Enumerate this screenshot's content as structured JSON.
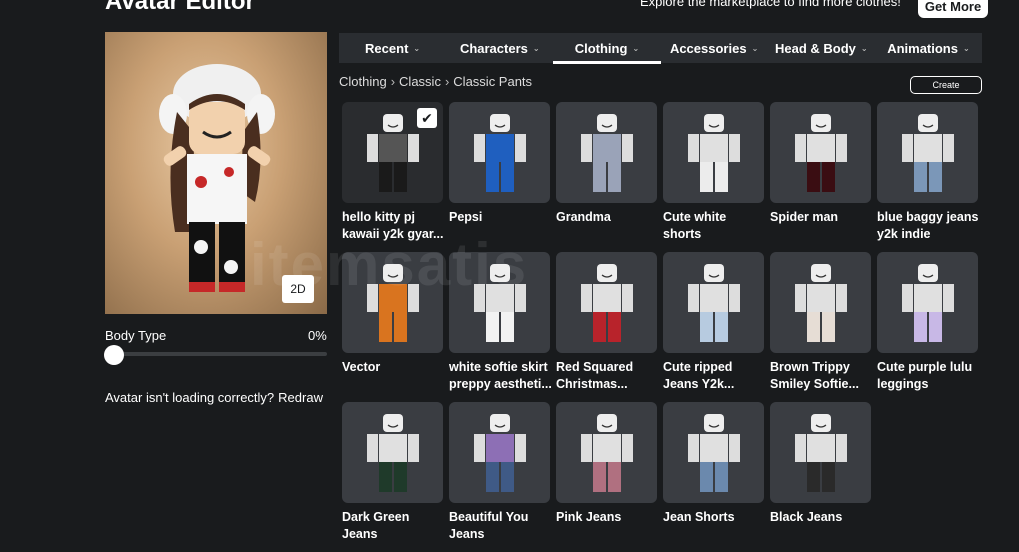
{
  "header": {
    "title": "Avatar Editor",
    "promo_text": "Explore the marketplace to find more clothes!",
    "get_more_label": "Get More"
  },
  "avatar": {
    "view_toggle_label": "2D",
    "body_type_label": "Body Type",
    "body_type_value": "0%",
    "body_type_level": 0,
    "loading_note": "Avatar isn't loading correctly?",
    "redraw_label": "Redraw"
  },
  "tabs": [
    {
      "label": "Recent",
      "active": false
    },
    {
      "label": "Characters",
      "active": false
    },
    {
      "label": "Clothing",
      "active": true
    },
    {
      "label": "Accessories",
      "active": false
    },
    {
      "label": "Head & Body",
      "active": false
    },
    {
      "label": "Animations",
      "active": false
    }
  ],
  "breadcrumb": [
    "Clothing",
    "Classic",
    "Classic Pants"
  ],
  "create_label": "Create",
  "items": [
    {
      "name": "hello kitty pj kawaii y2k gyar...",
      "selected": true,
      "pants": "#1a1a1a",
      "shirt": "#555555"
    },
    {
      "name": "Pepsi",
      "selected": false,
      "pants": "#1f5fbf",
      "shirt": "#1f5fbf"
    },
    {
      "name": "Grandma",
      "selected": false,
      "pants": "#9aa3b8",
      "shirt": "#9aa3b8"
    },
    {
      "name": "Cute white shorts",
      "selected": false,
      "pants": "#ececec",
      "shirt": "#e0e0e0"
    },
    {
      "name": "Spider man",
      "selected": false,
      "pants": "#3a0d12",
      "shirt": "#e0e0e0"
    },
    {
      "name": "blue baggy jeans y2k indie",
      "selected": false,
      "pants": "#7b97b8",
      "shirt": "#e0e0e0"
    },
    {
      "name": "Vector",
      "selected": false,
      "pants": "#d9741f",
      "shirt": "#d9741f"
    },
    {
      "name": "white softie skirt preppy aestheti...",
      "selected": false,
      "pants": "#f2f2f2",
      "shirt": "#e0e0e0"
    },
    {
      "name": "Red Squared Christmas...",
      "selected": false,
      "pants": "#b8232b",
      "shirt": "#e0e0e0"
    },
    {
      "name": "Cute ripped Jeans Y2k...",
      "selected": false,
      "pants": "#b7cbe0",
      "shirt": "#e0e0e0"
    },
    {
      "name": "Brown Trippy Smiley Softie...",
      "selected": false,
      "pants": "#e6ddd5",
      "shirt": "#e0e0e0"
    },
    {
      "name": "Cute purple lulu leggings",
      "selected": false,
      "pants": "#c8b8e6",
      "shirt": "#e0e0e0"
    },
    {
      "name": "Dark Green Jeans",
      "selected": false,
      "pants": "#1f3a2a",
      "shirt": "#e0e0e0"
    },
    {
      "name": "Beautiful You Jeans",
      "selected": false,
      "pants": "#3f5a86",
      "shirt": "#8d6fb5"
    },
    {
      "name": "Pink Jeans",
      "selected": false,
      "pants": "#b07080",
      "shirt": "#e0e0e0"
    },
    {
      "name": "Jean Shorts",
      "selected": false,
      "pants": "#6b89ad",
      "shirt": "#e0e0e0"
    },
    {
      "name": "Black Jeans",
      "selected": false,
      "pants": "#2a2a2a",
      "shirt": "#e0e0e0"
    }
  ],
  "watermark": "itemsatis"
}
